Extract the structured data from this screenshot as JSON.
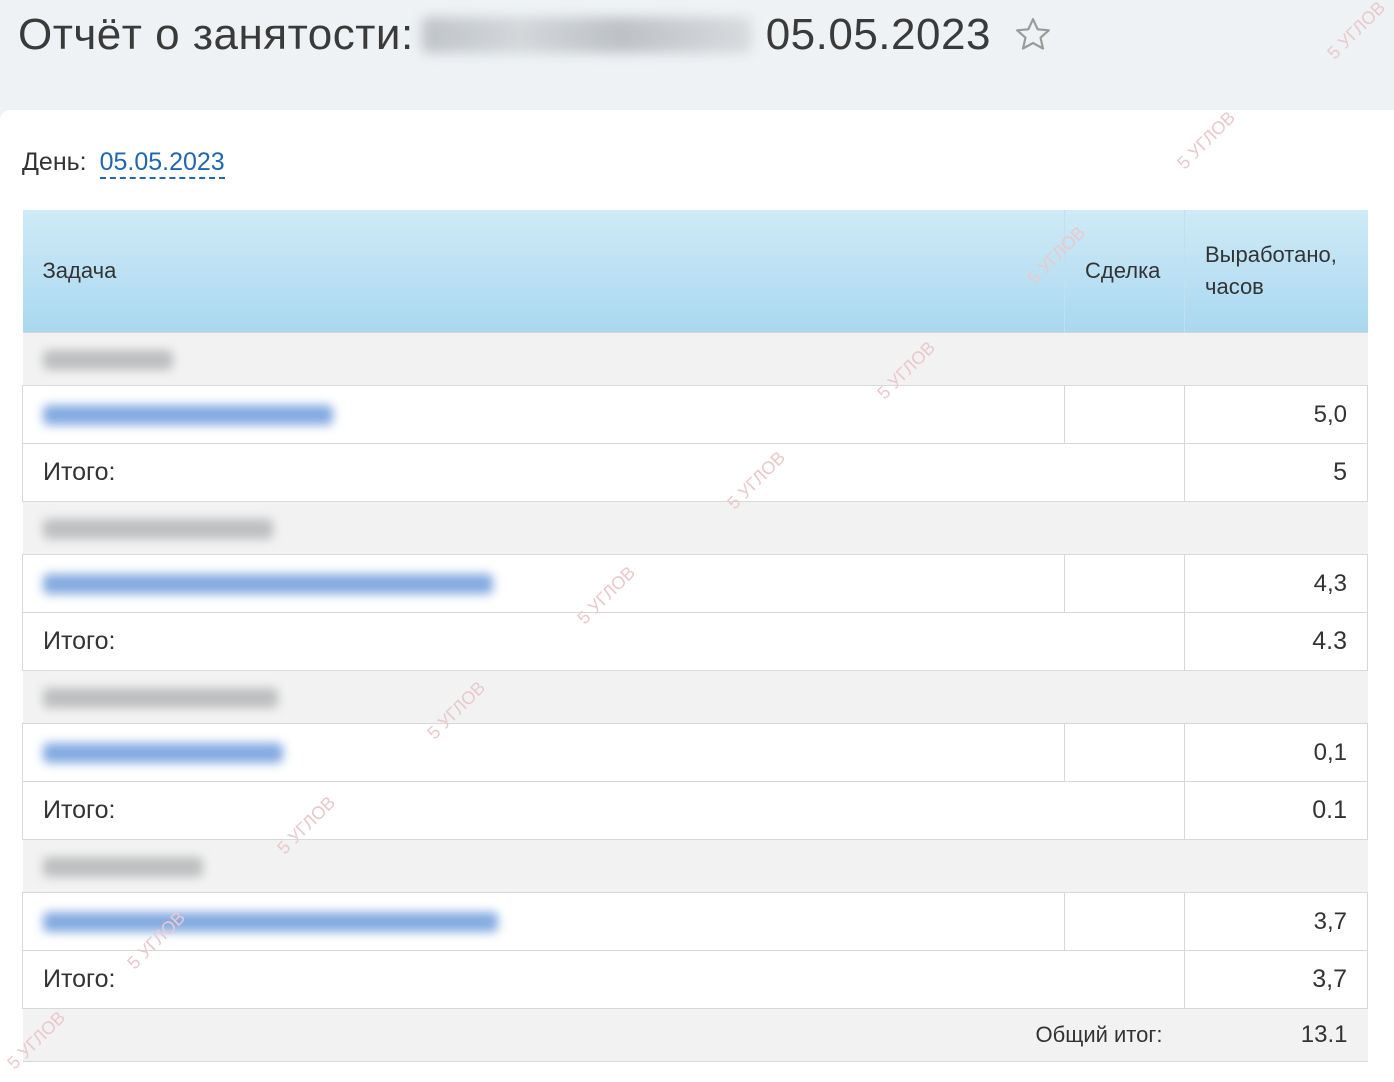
{
  "header": {
    "title_prefix": "Отчёт о занятости: ",
    "title_date": "05.05.2023"
  },
  "day": {
    "label": "День:",
    "value": "05.05.2023"
  },
  "table": {
    "columns": [
      "Задача",
      "Сделка",
      "Выработано, часов"
    ],
    "groups": [
      {
        "task_hours": "5,0",
        "subtotal_label": "Итого:",
        "subtotal": "5"
      },
      {
        "task_hours": "4,3",
        "subtotal_label": "Итого:",
        "subtotal": "4.3"
      },
      {
        "task_hours": "0,1",
        "subtotal_label": "Итого:",
        "subtotal": "0.1"
      },
      {
        "task_hours": "3,7",
        "subtotal_label": "Итого:",
        "subtotal": "3,7"
      }
    ],
    "grand_total_label": "Общий итог:",
    "grand_total": "13.1"
  },
  "watermark_text": "5 УГЛОВ",
  "colors": {
    "link": "#2067b0",
    "header_gradient_top": "#cfeaf7",
    "header_gradient_bottom": "#a9d8ef",
    "watermark": "#e9c9cc"
  }
}
